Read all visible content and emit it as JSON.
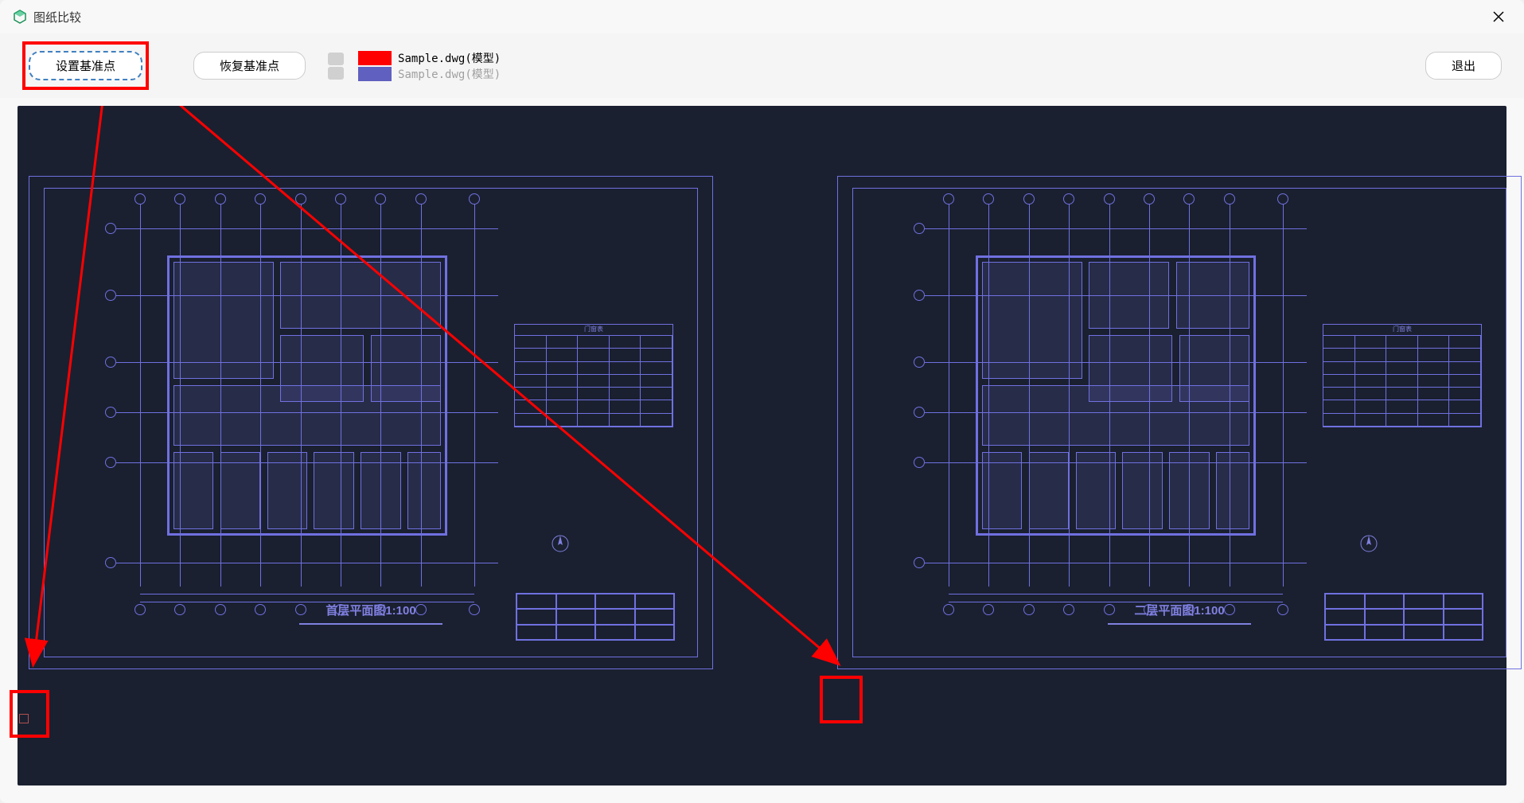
{
  "window": {
    "title": "图纸比较"
  },
  "toolbar": {
    "set_base_point_label": "设置基准点",
    "restore_base_point_label": "恢复基准点",
    "exit_label": "退出"
  },
  "legend": {
    "file1_label": "Sample.dwg(模型)",
    "file2_label": "Sample.dwg(模型)",
    "color1": "#ff0000",
    "color2": "#6060c0"
  },
  "drawings": {
    "left": {
      "title": "首层平面图1:100",
      "door_schedule_title": "门窗表"
    },
    "right": {
      "title": "二层平面图1:100",
      "door_schedule_title": "门窗表"
    }
  }
}
